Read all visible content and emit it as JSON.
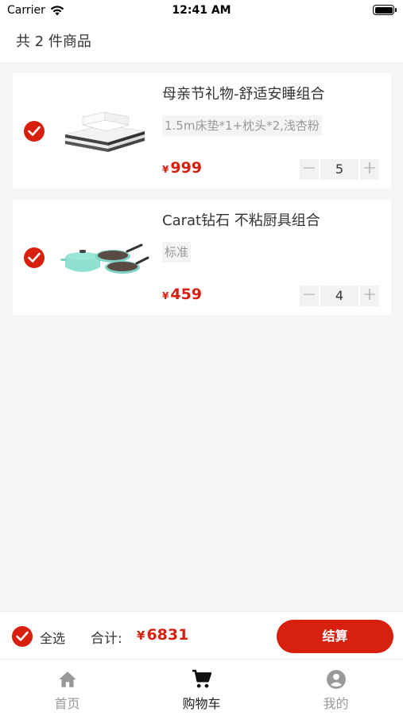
{
  "status": {
    "carrier": "Carrier",
    "time": "12:41 AM"
  },
  "header": {
    "title": "共 2 件商品"
  },
  "items": [
    {
      "title": "母亲节礼物-舒适安睡组合",
      "spec": "1.5m床垫*1+枕头*2,浅杏粉",
      "currency": "¥",
      "price": "999",
      "qty": "5",
      "minus": "−",
      "plus": "+",
      "checked": true,
      "thumb_icon": "bedding-image"
    },
    {
      "title": "Carat钻石 不粘厨具组合",
      "spec": "标准",
      "currency": "¥",
      "price": "459",
      "qty": "4",
      "minus": "−",
      "plus": "+",
      "checked": true,
      "thumb_icon": "cookware-image"
    }
  ],
  "checkout": {
    "select_all": "全选",
    "total_label": "合计:",
    "currency": "¥",
    "total": "6831",
    "button": "结算"
  },
  "tabs": [
    {
      "label": "首页",
      "icon": "home-icon",
      "active": false
    },
    {
      "label": "购物车",
      "icon": "cart-icon",
      "active": true
    },
    {
      "label": "我的",
      "icon": "profile-icon",
      "active": false
    }
  ],
  "colors": {
    "accent": "#d7200e",
    "background": "#f5f5f5"
  }
}
